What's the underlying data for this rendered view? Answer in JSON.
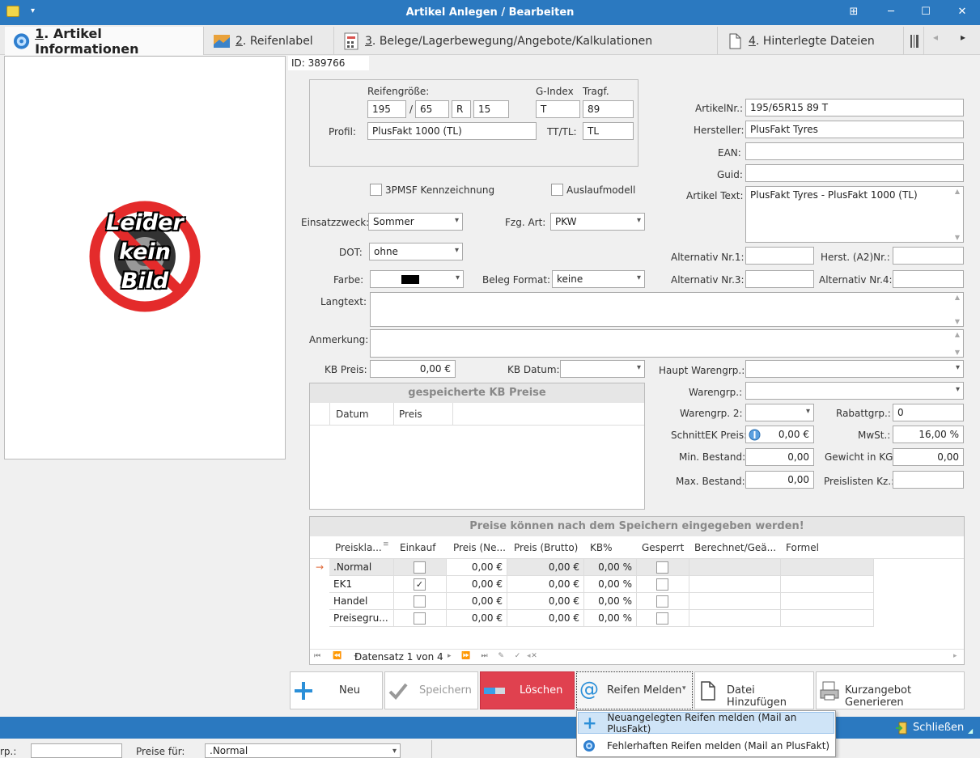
{
  "window": {
    "title": "Artikel Anlegen / Bearbeiten",
    "btn_snap": "⊞",
    "btn_min": "─",
    "btn_max": "☐",
    "btn_close": "✕"
  },
  "tabs": [
    {
      "num": "1",
      "label": ". Artikel Informationen"
    },
    {
      "num": "2",
      "label": ". Reifenlabel"
    },
    {
      "num": "3",
      "label": ". Belege/Lagerbewegung/Angebote/Kalkulationen"
    },
    {
      "num": "4",
      "label": ". Hinterlegte Dateien"
    }
  ],
  "tab_nav": {
    "prev": "◂",
    "next": "▸"
  },
  "no_image": {
    "line1": "Leider",
    "line2": "kein",
    "line3": "Bild"
  },
  "id_label": "ID: 389766",
  "tire": {
    "groesse_label": "Reifengröße:",
    "gindex_label": "G-Index",
    "tragf_label": "Tragf.",
    "width": "195",
    "slash": "/",
    "ratio": "65",
    "construction": "R",
    "rim": "15",
    "gindex": "T",
    "tragf": "89",
    "profil_label": "Profil:",
    "profil": "PlusFakt 1000 (TL)",
    "tttl_label": "TT/TL:",
    "tttl": "TL"
  },
  "flags": {
    "pmsf_label": "3PMSF Kennzeichnung",
    "auslauf_label": "Auslaufmodell"
  },
  "fields": {
    "einsatz_label": "Einsatzzweck:",
    "einsatz": "Sommer",
    "fzg_label": "Fzg. Art:",
    "fzg": "PKW",
    "dot_label": "DOT:",
    "dot": "ohne",
    "farbe_label": "Farbe:",
    "belegformat_label": "Beleg Format:",
    "belegformat": "keine",
    "langtext_label": "Langtext:",
    "anmerkung_label": "Anmerkung:",
    "kbpreis_label": "KB Preis:",
    "kbpreis": "0,00 €",
    "kbdatum_label": "KB Datum:"
  },
  "right": {
    "artikelnr_label": "ArtikelNr.:",
    "artikelnr": "195/65R15 89 T",
    "hersteller_label": "Hersteller:",
    "hersteller": "PlusFakt Tyres",
    "ean_label": "EAN:",
    "guid_label": "Guid:",
    "artikeltext_label": "Artikel Text:",
    "artikeltext": "PlusFakt Tyres - PlusFakt 1000 (TL)",
    "alt1_label": "Alternativ Nr.1:",
    "herst_a2_label": "Herst. (A2)Nr.:",
    "alt3_label": "Alternativ Nr.3:",
    "alt4_label": "Alternativ Nr.4:",
    "hauptwg_label": "Haupt Warengrp.:",
    "wg_label": "Warengrp.:",
    "wg2_label": "Warengrp. 2:",
    "rabatt_label": "Rabattgrp.:",
    "rabatt": "0",
    "schnittek_label": "SchnittEK Preis:",
    "schnittek": "0,00 €",
    "mwst_label": "MwSt.:",
    "mwst": "16,00 %",
    "minbestand_label": "Min. Bestand:",
    "minbestand": "0,00",
    "gewicht_label": "Gewicht in KG:",
    "gewicht": "0,00",
    "maxbestand_label": "Max. Bestand:",
    "maxbestand": "0,00",
    "preislisten_label": "Preislisten Kz.:"
  },
  "kb_section": {
    "title": "gespeicherte KB Preise",
    "col_datum": "Datum",
    "col_preis": "Preis"
  },
  "price_section": {
    "title": "Preise können nach dem Speichern eingegeben werden!",
    "headers": [
      "Preiskla...",
      "Einkauf",
      "Preis (Ne...",
      "Preis (Brutto)",
      "KB%",
      "Gesperrt",
      "Berechnet/Geä...",
      "Formel"
    ],
    "rows": [
      {
        "name": ".Normal",
        "einkauf": false,
        "netto": "0,00 €",
        "brutto": "0,00 €",
        "kb": "0,00 %",
        "gesperrt": false
      },
      {
        "name": "EK1",
        "einkauf": true,
        "netto": "0,00 €",
        "brutto": "0,00 €",
        "kb": "0,00 %",
        "gesperrt": false
      },
      {
        "name": "Handel",
        "einkauf": false,
        "netto": "0,00 €",
        "brutto": "0,00 €",
        "kb": "0,00 %",
        "gesperrt": false
      },
      {
        "name": "Preisegru...",
        "einkauf": false,
        "netto": "0,00 €",
        "brutto": "0,00 €",
        "kb": "0,00 %",
        "gesperrt": false
      }
    ],
    "navigator": "Datensatz 1 von 4",
    "row_indicator": "→",
    "check_mark": "✓"
  },
  "buttons": {
    "neu": "Neu",
    "speichern": "Speichern",
    "loeschen": "Löschen",
    "reifen_melden": "Reifen Melden",
    "datei": "Datei Hinzufügen",
    "kurzangebot": "Kurzangebot Generieren"
  },
  "popup": {
    "item1": "Neuangelegten Reifen melden (Mail an PlusFakt)",
    "item2": "Fehlerhaften Reifen melden (Mail an PlusFakt)"
  },
  "statusbar": {
    "schliessen": "Schließen"
  },
  "below": {
    "grp_label": "rp.:",
    "preise_label": "Preise für:",
    "preise_value": ".Normal"
  },
  "colors": {
    "titlebar": "#2b79c0",
    "delete_button": "#e0414f",
    "popup_highlight": "#cfe4f7"
  }
}
